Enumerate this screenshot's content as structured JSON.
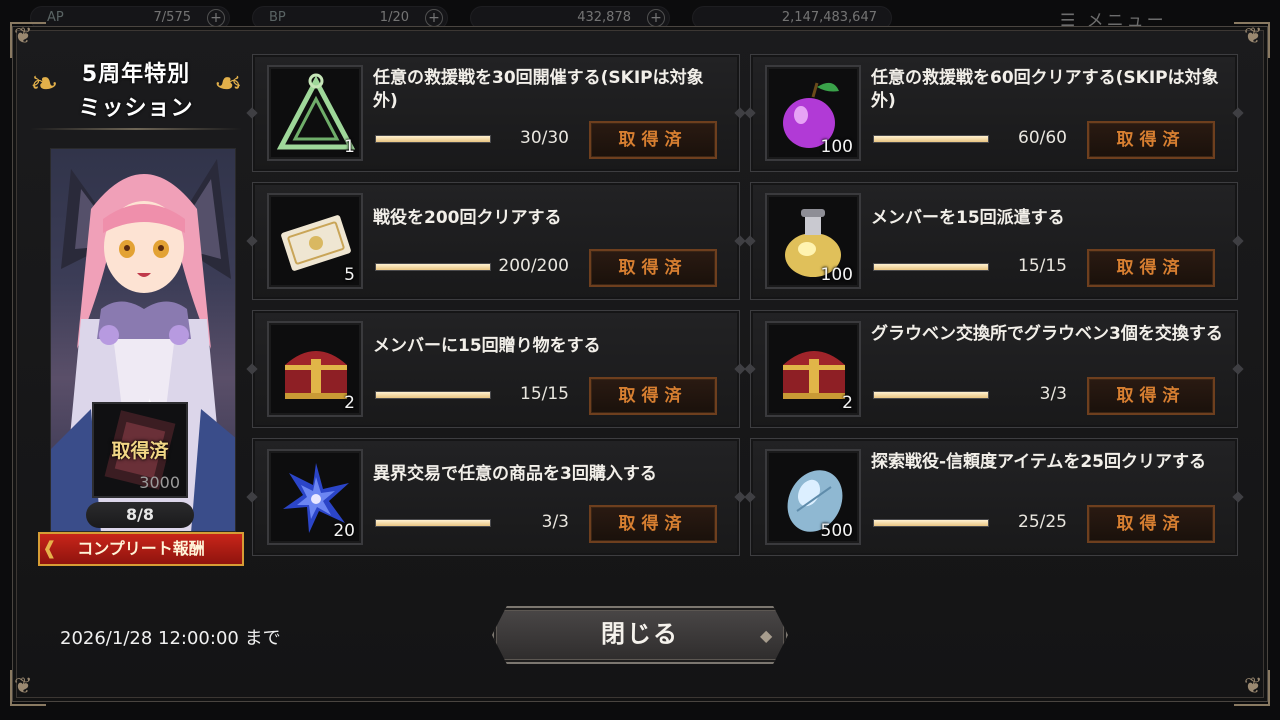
{
  "topbar": {
    "ap": {
      "label": "AP",
      "value": "7/575"
    },
    "bp": {
      "label": "BP",
      "value": "1/20"
    },
    "gold": {
      "value": "432,878"
    },
    "gems": {
      "value": "2,147,483,647"
    },
    "menu_label": "メニュー"
  },
  "event": {
    "title_line1": "5周年特別",
    "title_line2": "ミッション",
    "reward_status": "取得済",
    "reward_quantity": "3000",
    "progress": "8/8",
    "complete_label": "コンプリート報酬"
  },
  "missions": [
    {
      "text": "任意の救援戦を30回開催する(SKIPは対象外)",
      "item": "triangle-emblem-icon",
      "count": "1",
      "progress": "30/30",
      "fraction": 1.0,
      "button": "取得済"
    },
    {
      "text": "任意の救援戦を60回クリアする(SKIPは対象外)",
      "item": "purple-apple-icon",
      "count": "100",
      "progress": "60/60",
      "fraction": 1.0,
      "button": "取得済"
    },
    {
      "text": "戦役を200回クリアする",
      "item": "ticket-icon",
      "count": "5",
      "progress": "200/200",
      "fraction": 1.0,
      "button": "取得済"
    },
    {
      "text": "メンバーを15回派遣する",
      "item": "potion-bottle-icon",
      "count": "100",
      "progress": "15/15",
      "fraction": 1.0,
      "button": "取得済"
    },
    {
      "text": "メンバーに15回贈り物をする",
      "item": "treasure-chest-icon",
      "count": "2",
      "progress": "15/15",
      "fraction": 1.0,
      "button": "取得済"
    },
    {
      "text": "グラウベン交換所でグラウベン3個を交換する",
      "item": "treasure-chest-icon",
      "count": "2",
      "progress": "3/3",
      "fraction": 1.0,
      "button": "取得済"
    },
    {
      "text": "異界交易で任意の商品を3回購入する",
      "item": "blue-flower-icon",
      "count": "20",
      "progress": "3/3",
      "fraction": 1.0,
      "button": "取得済"
    },
    {
      "text": "探索戦役-信頼度アイテムを25回クリアする",
      "item": "crystal-egg-icon",
      "count": "500",
      "progress": "25/25",
      "fraction": 1.0,
      "button": "取得済"
    }
  ],
  "footer": {
    "deadline": "2026/1/28 12:00:00 まで",
    "close_label": "閉じる"
  },
  "colors": {
    "accent_orange": "#d77f31",
    "progress_fill": "#f0d08f",
    "complete_red": "#b41e15"
  }
}
